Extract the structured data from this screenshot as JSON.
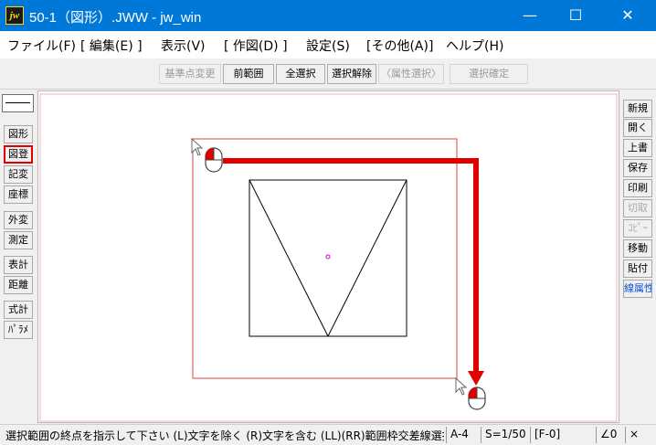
{
  "window": {
    "title": "50-1（図形）.JWW - jw_win",
    "app_icon_text": "jw",
    "minimize": "—",
    "maximize": "☐",
    "close": "✕"
  },
  "menu": {
    "items": [
      "ファイル(F)",
      "[ 編集(E) ]",
      "表示(V)",
      "[ 作図(D) ]",
      "設定(S)",
      "[その他(A)]",
      "ヘルプ(H)"
    ]
  },
  "toolbar": {
    "base_point": "基準点変更",
    "prev_range": "前範囲",
    "select_all": "全選択",
    "deselect": "選択解除",
    "attr_select": "〈属性選択〉",
    "confirm": "選択確定"
  },
  "left_toolbar": {
    "items": [
      "図形",
      "図登",
      "記変",
      "座標",
      "外変",
      "測定",
      "表計",
      "距離",
      "式計",
      "ﾊﾟﾗﾒ"
    ],
    "selected": "図登"
  },
  "right_toolbar": {
    "items": [
      "新規",
      "開く",
      "上書",
      "保存",
      "印刷",
      "切取",
      "ｺﾋﾟｰ",
      "移動",
      "貼付",
      "線属性"
    ]
  },
  "statusbar": {
    "message": "選択範囲の終点を指示して下さい (L)文字を除く (R)文字を含む (LL)(RR)範囲枠交差線選択",
    "paper": "A-4",
    "scale": "S=1/50",
    "layer": "[F-0]",
    "angle": "∠0",
    "zoom": "×"
  },
  "colors": {
    "titlebar": "#0078d7",
    "selection_frame": "#d44545",
    "drag_arrow": "#e00000",
    "point_marker": "#cc00cc"
  }
}
